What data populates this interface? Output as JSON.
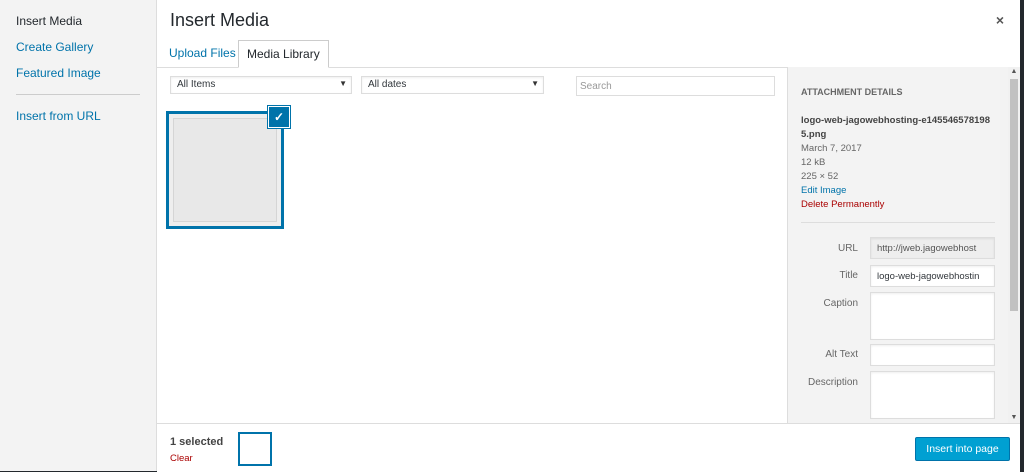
{
  "menu": {
    "items": [
      {
        "label": "Insert Media"
      },
      {
        "label": "Create Gallery"
      },
      {
        "label": "Featured Image"
      },
      {
        "label": "Insert from URL"
      }
    ]
  },
  "header": {
    "title": "Insert Media",
    "close_icon": "×"
  },
  "tabs": [
    {
      "label": "Upload Files"
    },
    {
      "label": "Media Library"
    }
  ],
  "toolbar": {
    "filter_type": "All Items",
    "filter_date": "All dates",
    "search_placeholder": "Search"
  },
  "attachment": {
    "heading": "ATTACHMENT DETAILS",
    "filename": "logo-web-jagowebhosting-e1455465781985.png",
    "date": "March 7, 2017",
    "size": "12 kB",
    "dimensions": "225 × 52",
    "edit_link": "Edit Image",
    "delete_link": "Delete Permanently",
    "fields": {
      "url_label": "URL",
      "url_value": "http://jweb.jagowebhost",
      "title_label": "Title",
      "title_value": "logo-web-jagowebhostin",
      "caption_label": "Caption",
      "caption_value": "",
      "alt_label": "Alt Text",
      "alt_value": "",
      "description_label": "Description",
      "description_value": ""
    }
  },
  "footer": {
    "selected_count": "1 selected",
    "clear_label": "Clear",
    "insert_button": "Insert into page"
  },
  "colors": {
    "accent": "#0073aa",
    "button": "#00a0d2",
    "danger": "#a00"
  }
}
